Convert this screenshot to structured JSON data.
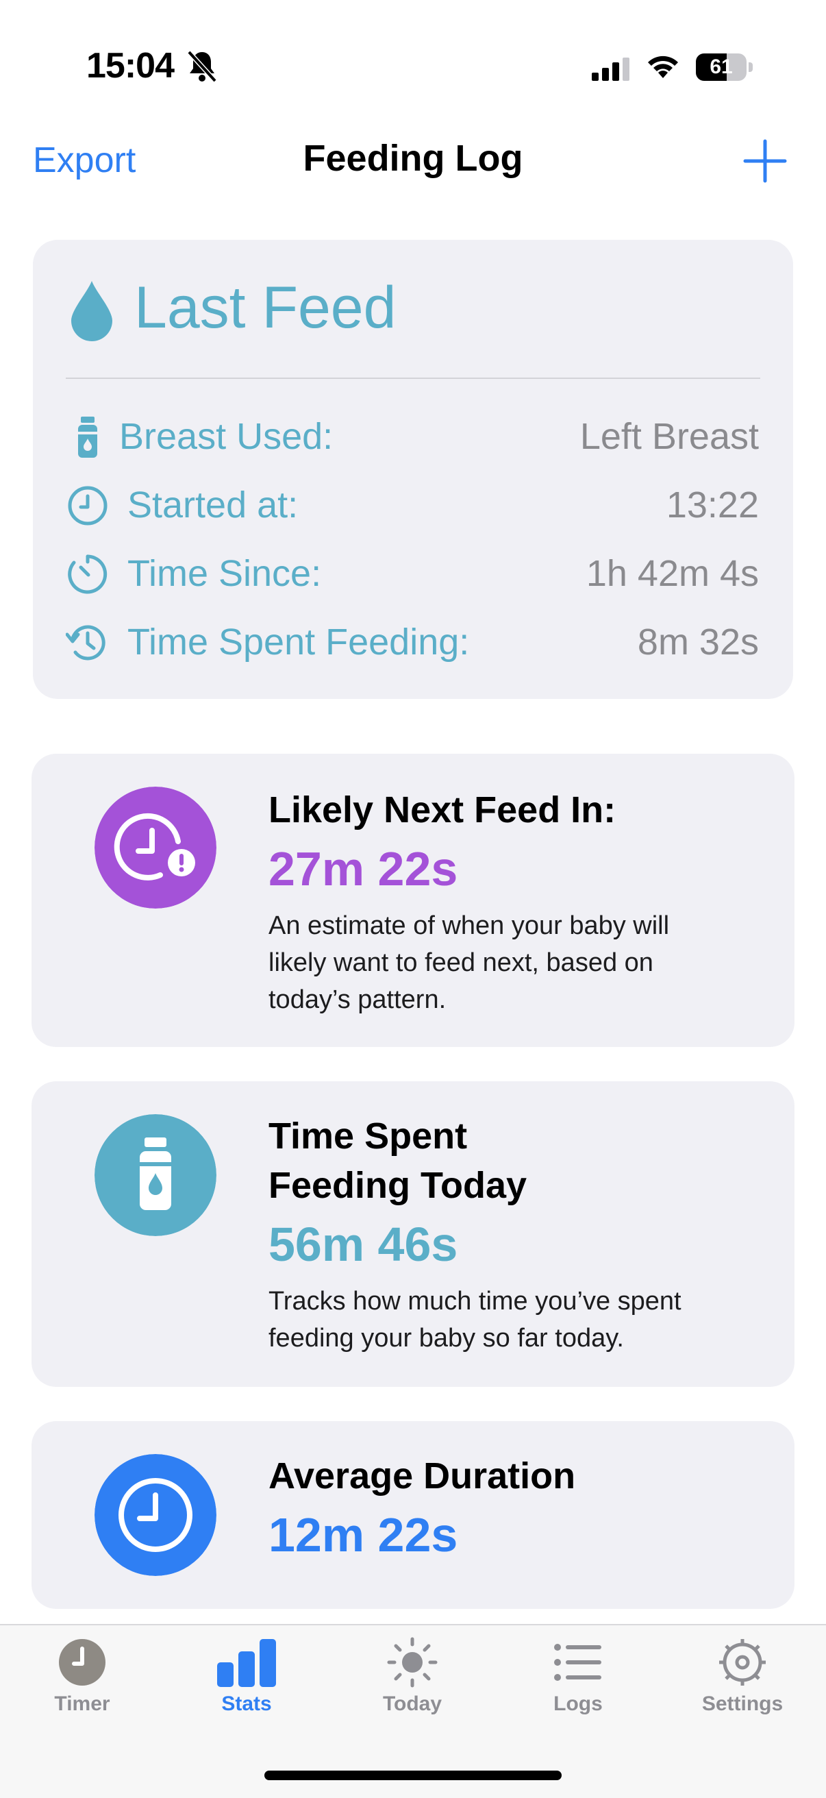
{
  "status_bar": {
    "time": "15:04",
    "battery": "61",
    "battery_level": 0.61
  },
  "nav": {
    "left_label": "Export",
    "title": "Feeding Log",
    "add_icon": "plus-icon"
  },
  "last_feed": {
    "title": "Last Feed",
    "rows": [
      {
        "icon": "bottle-icon",
        "label": "Breast Used:",
        "value": "Left Breast"
      },
      {
        "icon": "clock-icon",
        "label": "Started at:",
        "value": "13:22"
      },
      {
        "icon": "timer-icon",
        "label": "Time Since:",
        "value": "1h 42m 4s"
      },
      {
        "icon": "history-icon",
        "label": "Time Spent Feeding:",
        "value": "8m 32s"
      }
    ]
  },
  "stats": [
    {
      "icon": "clock-alert-icon",
      "title": "Likely Next Feed In:",
      "value": "27m 22s",
      "description": "An estimate of when your baby will likely want to feed next, based on today’s pattern.",
      "color": "#a452d8"
    },
    {
      "icon": "bottle-icon",
      "title": "Time Spent Feeding Today",
      "value": "56m 46s",
      "description": "Tracks how much time you’ve spent feeding your baby so far today.",
      "color": "#5aaec8"
    },
    {
      "icon": "clock-icon",
      "title": "Average Duration",
      "value": "12m 22s",
      "description": "",
      "color": "#2f7ff3"
    }
  ],
  "stats_title_lines": {
    "second_line_1": "Time Spent",
    "second_line_2": "Feeding Today",
    "desc1_l1": "An estimate of when your baby will",
    "desc1_l2": "likely want to feed next, based on",
    "desc1_l3": "today’s pattern.",
    "desc2_l1": "Tracks how much time you’ve spent",
    "desc2_l2": "feeding your baby so far today."
  },
  "tabs": [
    {
      "label": "Timer",
      "icon": "timer-icon",
      "active": false
    },
    {
      "label": "Stats",
      "icon": "bar-chart-icon",
      "active": true
    },
    {
      "label": "Today",
      "icon": "sun-icon",
      "active": false
    },
    {
      "label": "Logs",
      "icon": "list-icon",
      "active": false
    },
    {
      "label": "Settings",
      "icon": "gear-icon",
      "active": false
    }
  ],
  "colors": {
    "accent": "#2f7ff3",
    "teal": "#5aaec8",
    "purple": "#a452d8",
    "card": "#f0f0f5",
    "inactive": "#8e8e93"
  }
}
